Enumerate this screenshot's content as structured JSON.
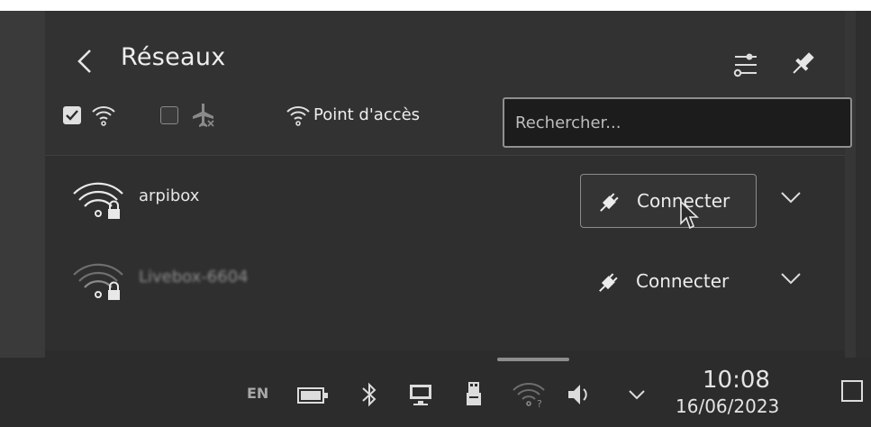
{
  "window": {
    "title": "Réseaux"
  },
  "filters": {
    "wifi_checked": true,
    "airplane_checked": false,
    "hotspot_label": "Point d'accès"
  },
  "search": {
    "placeholder": "Rechercher...",
    "value": ""
  },
  "networks": [
    {
      "name": "arpibox",
      "action_label": "Connecter",
      "secured": true,
      "hovered": true
    },
    {
      "name": "Livebox-6604",
      "action_label": "Connecter",
      "secured": true,
      "hovered": false
    }
  ],
  "taskbar": {
    "language": "EN",
    "time": "10:08",
    "date": "16/06/2023"
  },
  "icons": {
    "back": "chevron-left-icon",
    "configure": "configure-icon",
    "pin": "pin-icon",
    "wifi": "wifi-icon",
    "airplane": "airplane-icon",
    "hotspot": "hotspot-icon",
    "plug": "plug-icon",
    "expand": "chevron-down-icon"
  },
  "colors": {
    "panel_bg": "#313131",
    "text": "#e8e8e8",
    "search_bg": "#1c1c1c",
    "taskbar_bg": "#2c2c2c"
  }
}
